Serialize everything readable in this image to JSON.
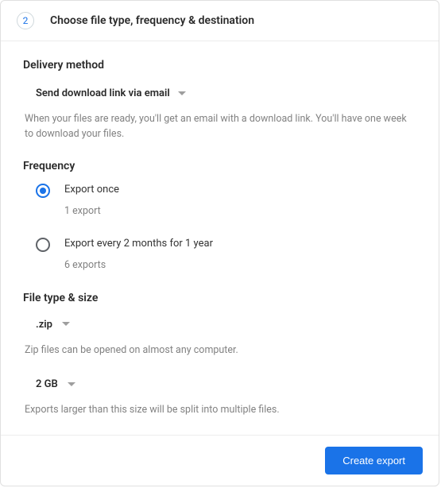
{
  "header": {
    "step": "2",
    "title": "Choose file type, frequency & destination"
  },
  "delivery": {
    "title": "Delivery method",
    "selected": "Send download link via email",
    "helper": "When your files are ready, you'll get an email with a download link. You'll have one week to download your files."
  },
  "frequency": {
    "title": "Frequency",
    "options": [
      {
        "label": "Export once",
        "sub": "1 export",
        "selected": true
      },
      {
        "label": "Export every 2 months for 1 year",
        "sub": "6 exports",
        "selected": false
      }
    ]
  },
  "filetype": {
    "title": "File type & size",
    "type_selected": ".zip",
    "type_helper": "Zip files can be opened on almost any computer.",
    "size_selected": "2 GB",
    "size_helper": "Exports larger than this size will be split into multiple files."
  },
  "footer": {
    "create_label": "Create export"
  }
}
